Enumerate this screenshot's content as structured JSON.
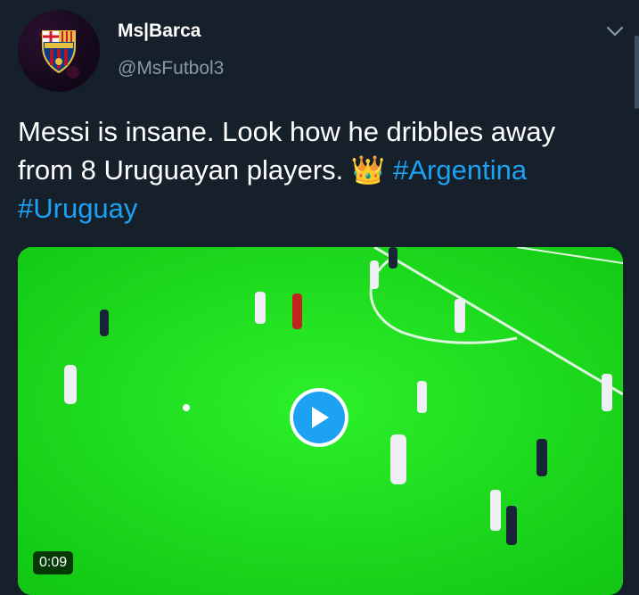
{
  "tweet": {
    "author_name": "Ms|Barca",
    "author_handle": "@MsFutbol3",
    "text_line1": "Messi is insane. Look how he dribbles away",
    "text_line2": "from 8 Uruguayan players. ",
    "emoji": "👑",
    "hashtag1": "#Argentina",
    "hashtag2": "#Uruguay"
  },
  "media": {
    "duration": "0:09",
    "play_icon": "play-icon"
  },
  "avatar": {
    "crest_letters": "FCB"
  },
  "colors": {
    "background": "#15202b",
    "accent": "#1da1f2",
    "secondary_text": "#8899a6",
    "pitch": "#1fe01e"
  }
}
